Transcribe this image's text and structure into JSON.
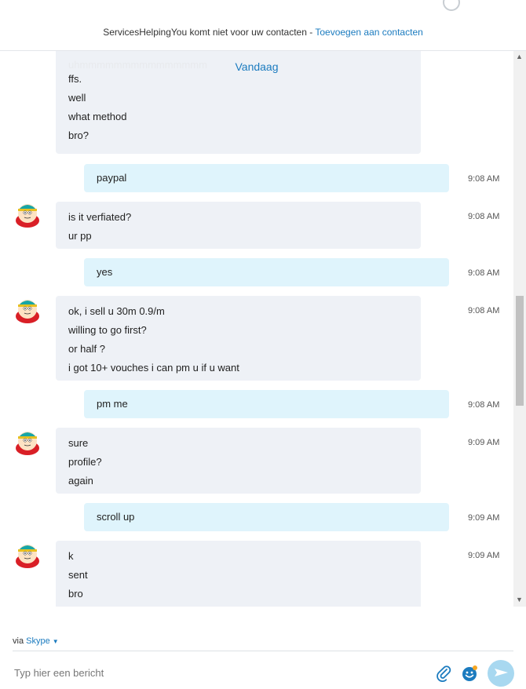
{
  "header": {
    "notice_text": "ServicesHelpingYou komt niet voor uw contacten - ",
    "add_contact_link": "Toevoegen aan contacten"
  },
  "chat": {
    "day_label": "Vandaag",
    "faded_text": "uhmmmmmmmmmmmmmmm",
    "messages": [
      {
        "dir": "in",
        "lines": [
          "ffs.",
          "well",
          "what method",
          "bro?"
        ],
        "time": ""
      },
      {
        "dir": "out",
        "lines": [
          "paypal"
        ],
        "time": "9:08 AM"
      },
      {
        "dir": "in",
        "lines": [
          "is it verfiated?",
          "ur pp"
        ],
        "time": "9:08 AM"
      },
      {
        "dir": "out",
        "lines": [
          "yes"
        ],
        "time": "9:08 AM"
      },
      {
        "dir": "in",
        "lines": [
          "ok, i sell u 30m 0.9/m",
          "willing to go first?",
          "or half ?",
          "i got 10+ vouches i can pm u if u want"
        ],
        "time": "9:08 AM"
      },
      {
        "dir": "out",
        "lines": [
          "pm me"
        ],
        "time": "9:08 AM"
      },
      {
        "dir": "in",
        "lines": [
          "sure",
          "profile?",
          "again"
        ],
        "time": "9:09 AM"
      },
      {
        "dir": "out",
        "lines": [
          "scroll up"
        ],
        "time": "9:09 AM"
      },
      {
        "dir": "in",
        "lines": [
          "k",
          "sent",
          "bro"
        ],
        "time": "9:09 AM"
      }
    ]
  },
  "composer": {
    "via_prefix": "via ",
    "via_service": "Skype",
    "placeholder": "Typ hier een bericht"
  },
  "icons": {
    "attach": "paperclip-icon",
    "emoji": "emoji-icon",
    "send": "send-icon",
    "avatar": "cartman-avatar"
  },
  "colors": {
    "accent": "#1b7bbf",
    "incoming_bubble": "#eef1f6",
    "outgoing_bubble": "#dff4fc",
    "send_button": "#a8d8f0"
  }
}
